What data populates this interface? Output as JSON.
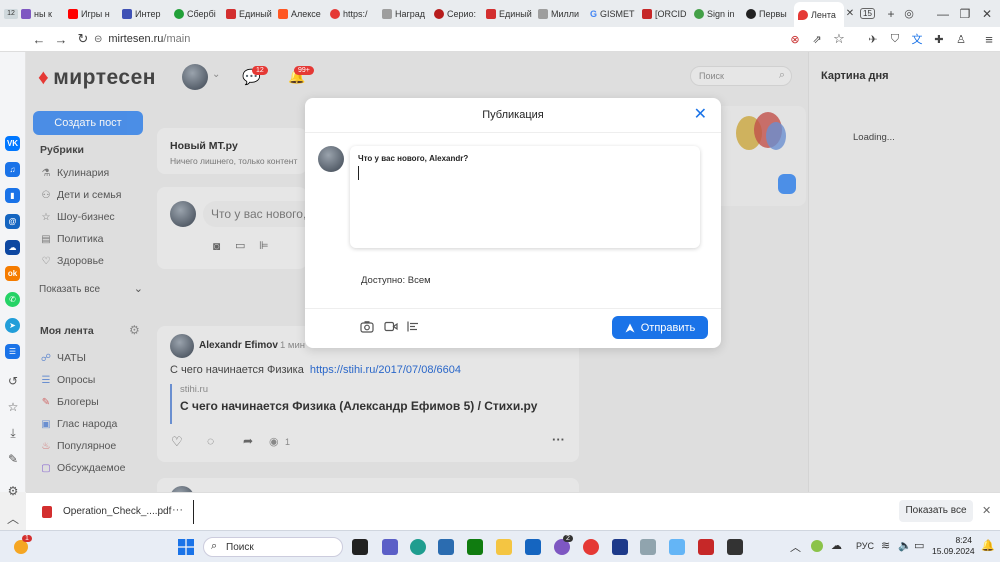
{
  "browser": {
    "tabs": [
      {
        "label": "ны к",
        "color": "#7e57c2"
      },
      {
        "label": "Игры н",
        "color": "#ff0000"
      },
      {
        "label": "Интер",
        "color": "#3f51b5"
      },
      {
        "label": "Сбербi",
        "color": "#21a038"
      },
      {
        "label": "Единый",
        "color": "#d32f2f"
      },
      {
        "label": "Алексе",
        "color": "#ff5722"
      },
      {
        "label": "https:/",
        "color": "#e53935"
      },
      {
        "label": "Наград",
        "color": "#9e9e9e"
      },
      {
        "label": "Серио:",
        "color": "#b71c1c"
      },
      {
        "label": "Единый",
        "color": "#d32f2f"
      },
      {
        "label": "Милли",
        "color": "#9e9e9e"
      },
      {
        "label": "GISMET",
        "color": "#4285f4"
      },
      {
        "label": "[ORCID",
        "color": "#c62828"
      },
      {
        "label": "Sign in",
        "color": "#43a047"
      },
      {
        "label": "Первы",
        "color": "#212121"
      }
    ],
    "first_tab_count": "12",
    "active_tab_label": "Лента",
    "tab_count": "15",
    "url_host": "mirtesen.ru",
    "url_path": "/main"
  },
  "site": {
    "logo": "миртесен",
    "messages_badge": "12",
    "notifications_badge": "99+",
    "search_placeholder": "Поиск",
    "create_post": "Создать пост",
    "rubrics_title": "Рубрики",
    "rubrics": [
      "Кулинария",
      "Дети и семья",
      "Шоу-бизнес",
      "Политика",
      "Здоровье"
    ],
    "show_all": "Показать все",
    "my_feed": "Моя лента",
    "feed_items": [
      "ЧАТЫ",
      "Опросы",
      "Блогеры",
      "Глас народа",
      "Популярное",
      "Обсуждаемое"
    ],
    "new_mt_title": "Новый МТ.ру",
    "new_mt_subtitle": "Ничего лишнего, только контент",
    "whats_new_placeholder": "Что у вас нового,",
    "post": {
      "author": "Alexandr Efimov",
      "time": "1 мин",
      "text": "С чего начинается Физика",
      "link": "https://stihi.ru/2017/07/08/6604",
      "source": "stihi.ru",
      "preview_title": "С чего начинается Физика (Александр Ефимов 5) / Стихи.ру",
      "views": "1"
    },
    "right_panel_title": "Картина дня",
    "right_panel_loading": "Loading..."
  },
  "modal": {
    "title": "Публикация",
    "composer_prompt": "Что у вас нового, Alexandr?",
    "audience": "Доступно: Всем",
    "send_label": "Отправить"
  },
  "download": {
    "filename": "Operation_Check_....pdf",
    "more": "···",
    "show_all": "Показать все"
  },
  "taskbar": {
    "search_label": "Поиск",
    "lang": "РУС",
    "time": "8:24",
    "date": "15.09.2024",
    "notification_badge": "1",
    "app_badge": "2"
  }
}
